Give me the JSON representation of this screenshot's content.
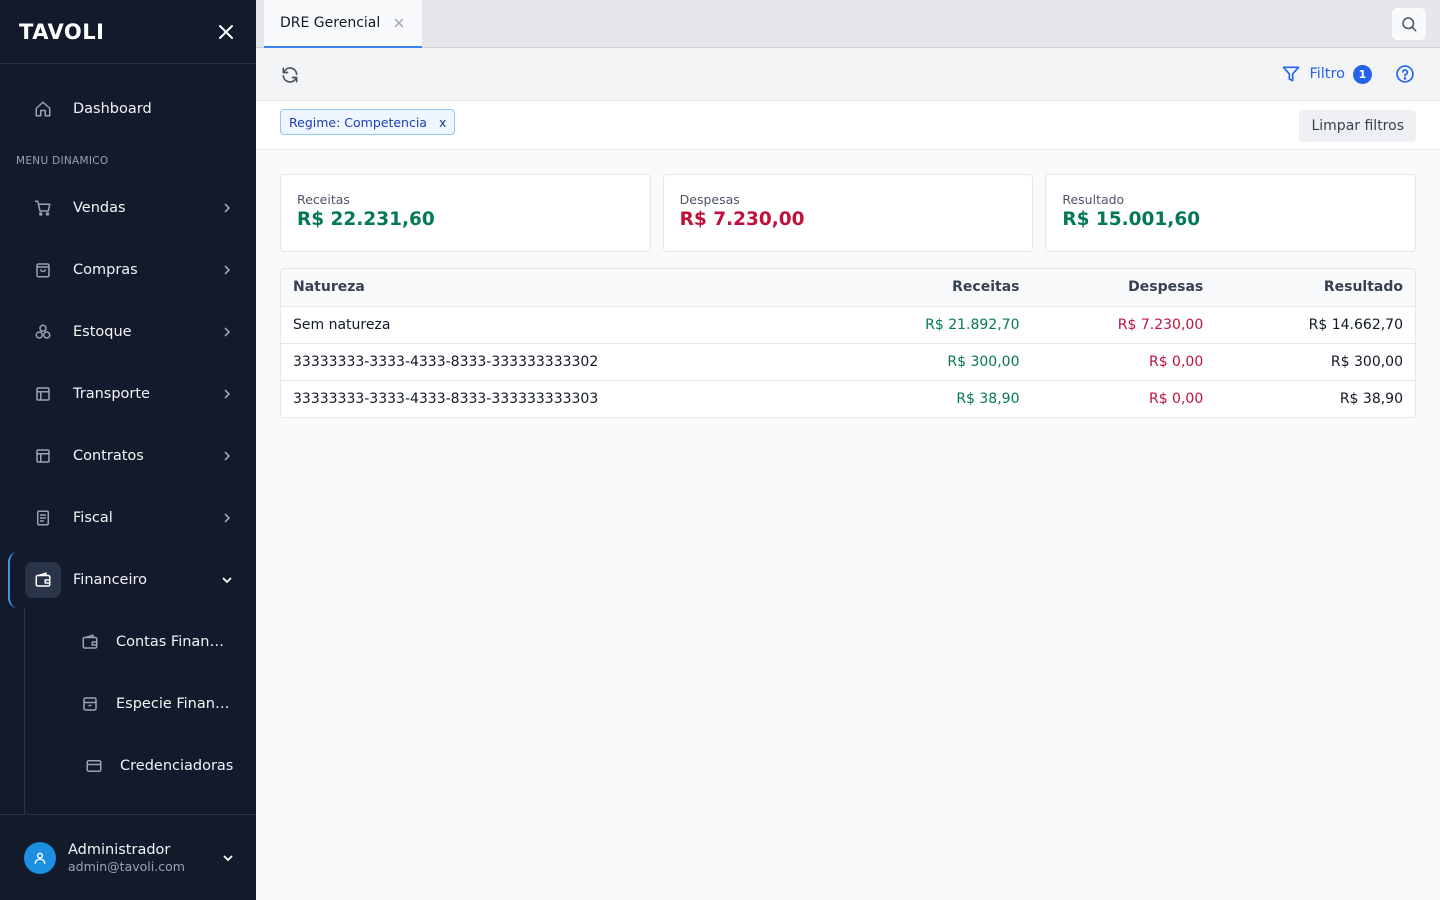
{
  "app": {
    "logo": "TAVOLI"
  },
  "sidebar": {
    "dashboard": {
      "label": "Dashboard",
      "icon": "home-icon"
    },
    "section_label": "MENU DINAMICO",
    "items": [
      {
        "label": "Vendas",
        "icon": "cart-icon"
      },
      {
        "label": "Compras",
        "icon": "shopping-bag-icon"
      },
      {
        "label": "Estoque",
        "icon": "boxes-icon"
      },
      {
        "label": "Transporte",
        "icon": "layout-icon"
      },
      {
        "label": "Contratos",
        "icon": "layout-icon"
      },
      {
        "label": "Fiscal",
        "icon": "document-icon"
      },
      {
        "label": "Financeiro",
        "icon": "wallet-icon"
      }
    ],
    "subitems": [
      {
        "label": "Contas Financeiras",
        "icon": "wallet-icon"
      },
      {
        "label": "Especie Financeira",
        "icon": "archive-icon"
      },
      {
        "label": "Credenciadoras",
        "icon": "credit-card-icon"
      }
    ],
    "user": {
      "name": "Administrador",
      "email": "admin@tavoli.com"
    }
  },
  "tabs": [
    {
      "label": "DRE Gerencial",
      "active": true
    }
  ],
  "toolbar": {
    "filter_label": "Filtro",
    "filter_count": "1"
  },
  "filters": {
    "chips": [
      {
        "label": "Regime: Competencia",
        "remove": "x"
      }
    ],
    "clear_label": "Limpar filtros"
  },
  "summary": {
    "receitas": {
      "label": "Receitas",
      "value": "R$ 22.231,60"
    },
    "despesas": {
      "label": "Despesas",
      "value": "R$ 7.230,00"
    },
    "resultado": {
      "label": "Resultado",
      "value": "R$ 15.001,60"
    }
  },
  "table": {
    "headers": [
      "Natureza",
      "Receitas",
      "Despesas",
      "Resultado"
    ],
    "rows": [
      [
        "Sem natureza",
        "R$ 21.892,70",
        "R$ 7.230,00",
        "R$ 14.662,70"
      ],
      [
        "33333333-3333-4333-8333-333333333302",
        "R$ 300,00",
        "R$ 0,00",
        "R$ 300,00"
      ],
      [
        "33333333-3333-4333-8333-333333333303",
        "R$ 38,90",
        "R$ 0,00",
        "R$ 38,90"
      ]
    ]
  },
  "colors": {
    "sidebar_bg": "#121a2b",
    "accent": "#2563eb",
    "positive": "#047857",
    "negative": "#be123c"
  }
}
